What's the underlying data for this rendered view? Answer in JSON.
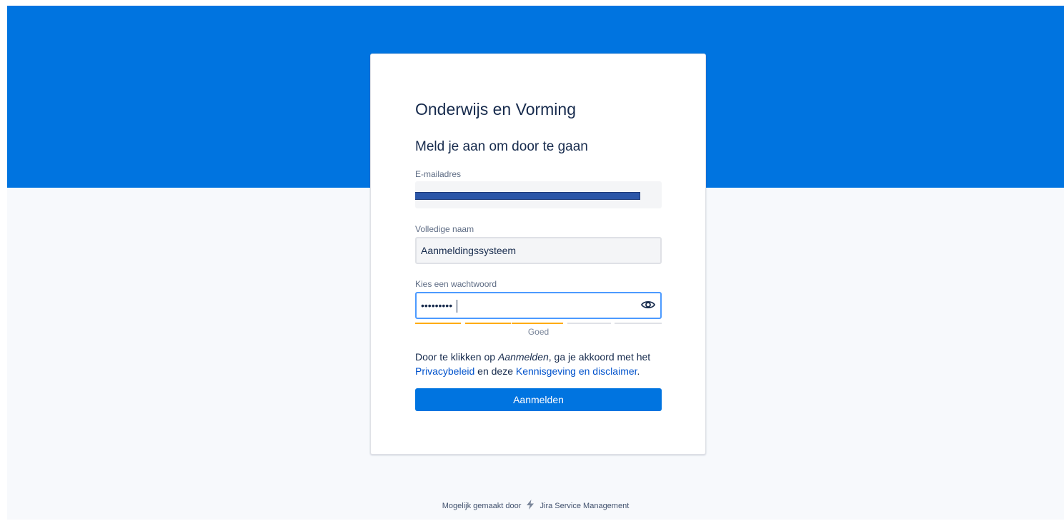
{
  "portal": {
    "title": "Onderwijs en Vorming",
    "subtitle": "Meld je aan om door te gaan"
  },
  "form": {
    "email": {
      "label": "E-mailadres",
      "value": "",
      "redacted": true
    },
    "full_name": {
      "label": "Volledige naam",
      "value": "Aanmeldingssysteem"
    },
    "password": {
      "label": "Kies een wachtwoord",
      "value": "•••••••••",
      "toggle_icon": "eye-icon"
    },
    "strength": {
      "label": "Goed",
      "filled_segments": 3,
      "total_segments": 5,
      "filled_color": "#ffab00",
      "empty_color": "#dfe1e6"
    },
    "terms": {
      "prefix": "Door te klikken op ",
      "action_word": "Aanmelden",
      "middle": ", ga je akkoord met het ",
      "privacy_link": "Privacybeleid",
      "connector": " en deze ",
      "notice_link": "Kennisgeving en disclaimer",
      "suffix": "."
    },
    "submit_label": "Aanmelden"
  },
  "footer": {
    "prefix": "Mogelijk gemaakt door",
    "product": "Jira Service Management",
    "icon": "lightning-bolt-icon"
  },
  "colors": {
    "brand": "#0074e0",
    "link": "#0052cc",
    "focus_border": "#4c9aff",
    "redaction": "#2b56a8"
  }
}
